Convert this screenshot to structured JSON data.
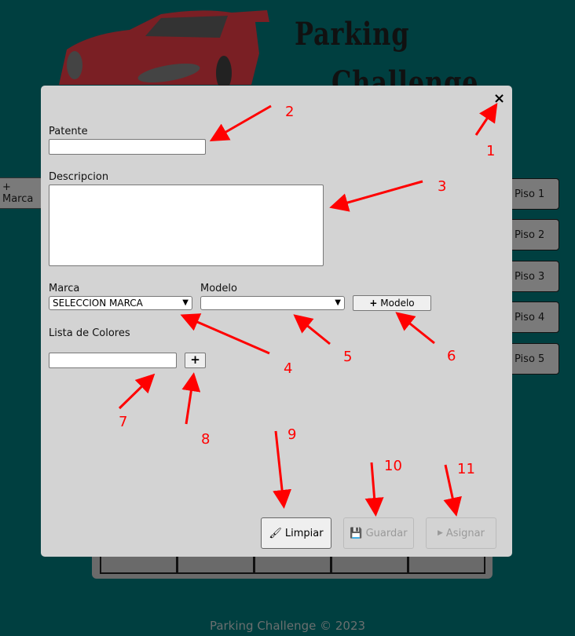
{
  "header": {
    "title_line1": "Parking",
    "title_line2": "Challenge"
  },
  "sidebar": {
    "add_marca_label": "+ Marca"
  },
  "floors": [
    "Piso 1",
    "Piso 2",
    "Piso 3",
    "Piso 4",
    "Piso 5"
  ],
  "modal": {
    "close_icon": "×",
    "patente_label": "Patente",
    "patente_value": "",
    "descripcion_label": "Descripcion",
    "descripcion_value": "",
    "marca_label": "Marca",
    "marca_selected": "SELECCION MARCA",
    "modelo_label": "Modelo",
    "modelo_selected": "",
    "add_modelo_label": "Modelo",
    "colores_label": "Lista de Colores",
    "color_value": "",
    "add_color_label": "+",
    "limpiar_label": "Limpiar",
    "guardar_label": "Guardar",
    "asignar_label": "Asignar"
  },
  "annotations": [
    "1",
    "2",
    "3",
    "4",
    "5",
    "6",
    "7",
    "8",
    "9",
    "10",
    "11"
  ],
  "footer": "Parking Challenge © 2023",
  "colors": {
    "background": "#003f40",
    "modal": "#d3d3d3",
    "annotation": "#ff0000"
  }
}
